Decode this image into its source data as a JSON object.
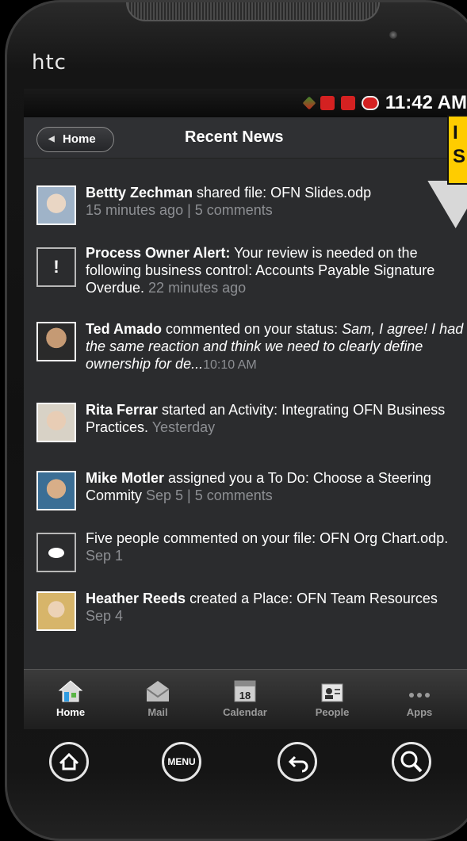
{
  "brand": "htc",
  "status": {
    "time": "11:42 AM"
  },
  "header": {
    "back_label": "Home",
    "title": "Recent News"
  },
  "feed": [
    {
      "name": "Bettty Zechman",
      "text": " shared file: OFN Slides.odp",
      "meta": "15 minutes ago | 5 comments"
    },
    {
      "name": "Process Owner Alert:",
      "text": " Your review is needed on the following business control: Accounts Payable Signature Overdue. ",
      "meta": "22 minutes ago"
    },
    {
      "name": "Ted Amado",
      "text": " commented on your status: ",
      "quote": "Sam, I agree! I had the same reaction and think we need to clearly define ownership for de...",
      "meta": "10:10 AM"
    },
    {
      "name": "Rita Ferrar",
      "text": " started an Activity: Integrating OFN Business Practices. ",
      "meta": "Yesterday"
    },
    {
      "name": "Mike Motler",
      "text": " assigned you a To Do: Choose a Steering Commity ",
      "meta": "Sep 5 | 5 comments"
    },
    {
      "name": "",
      "text": "Five people commented on your file: OFN Org Chart.odp. ",
      "meta": "Sep 1"
    },
    {
      "name": "Heather Reeds",
      "text": " created a Place: OFN Team Resources ",
      "meta": "Sep 4"
    }
  ],
  "alert_icon": "!",
  "tabs": [
    {
      "label": "Home",
      "icon": "house-icon"
    },
    {
      "label": "Mail",
      "icon": "envelope-icon"
    },
    {
      "label": "Calendar",
      "icon": "calendar-icon",
      "day": "18"
    },
    {
      "label": "People",
      "icon": "contact-card-icon"
    },
    {
      "label": "Apps",
      "icon": "dots-icon"
    }
  ],
  "hardware": {
    "menu_label": "MENU"
  },
  "callout_fragment": [
    "I",
    "S"
  ],
  "colors": {
    "accent_callout": "#ffcc00",
    "screen_bg": "#2b2c2e",
    "muted_text": "#8d8f93"
  }
}
